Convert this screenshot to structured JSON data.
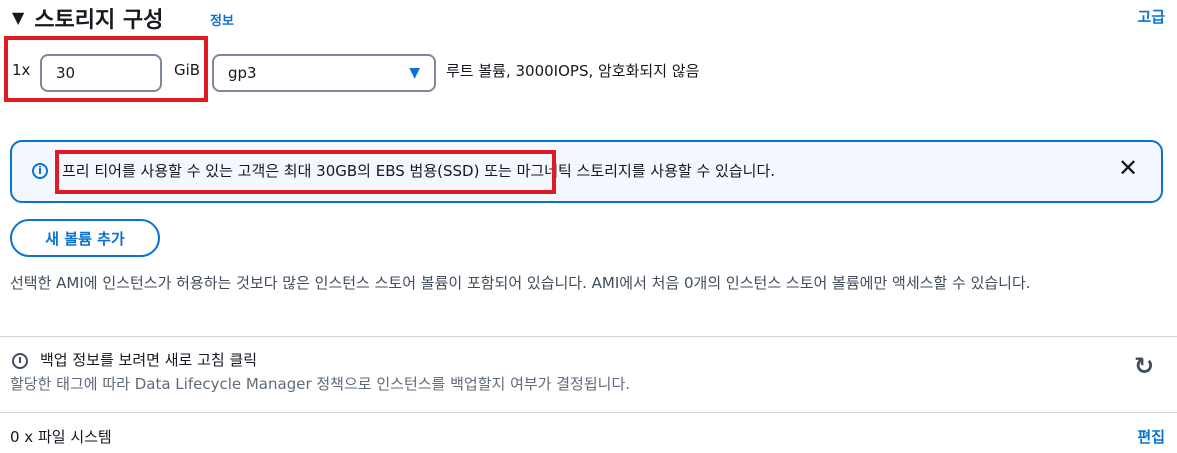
{
  "section": {
    "caret": "▼",
    "title": "스토리지 구성",
    "info_link": "정보",
    "advanced_link": "고급"
  },
  "volume": {
    "prefix": "1x",
    "size_value": "30",
    "unit": "GiB",
    "type_value": "gp3",
    "description": "루트 볼륨,  3000IOPS,  암호화되지 않음"
  },
  "alert": {
    "icon": "info-icon",
    "text": "프리 티어를 사용할 수 있는 고객은 최대 30GB의 EBS 범용(SSD) 또는 마그네틱 스토리지를 사용할 수 있습니다.",
    "close": "✕"
  },
  "add_volume_button": "새 볼륨 추가",
  "instance_store_note": "선택한 AMI에 인스턴스가 허용하는 것보다 많은 인스턴스 스토어 볼륨이 포함되어 있습니다. AMI에서 처음 0개의 인스턴스 스토어 볼륨에만 액세스할 수 있습니다.",
  "backup": {
    "title": "백업 정보를 보려면 새로 고침 클릭",
    "description": "할당한 태그에 따라 Data Lifecycle Manager 정책으로 인스턴스를 백업할지 여부가 결정됩니다.",
    "refresh_icon": "refresh-icon"
  },
  "file_systems": {
    "label": "0 x 파일 시스템",
    "edit_link": "편집"
  },
  "colors": {
    "accent": "#0972d3",
    "highlight": "#e01b24",
    "alert_bg": "#f2f8fd"
  }
}
